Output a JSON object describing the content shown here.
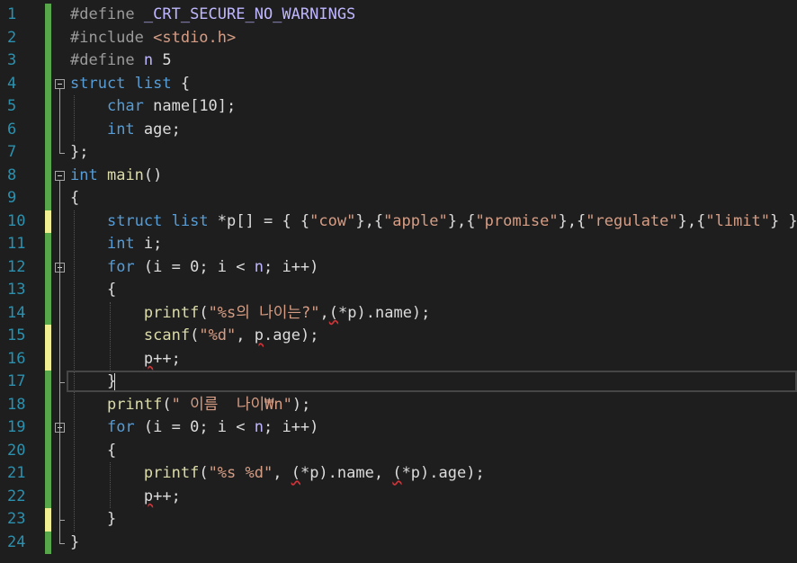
{
  "editor": {
    "lines": [
      {
        "n": "1",
        "tokens": [
          {
            "c": "pp",
            "t": "#define "
          },
          {
            "c": "macro",
            "t": "_CRT_SECURE_NO_WARNINGS"
          }
        ]
      },
      {
        "n": "2",
        "tokens": [
          {
            "c": "pp",
            "t": "#include "
          },
          {
            "c": "str",
            "t": "<stdio.h>"
          }
        ]
      },
      {
        "n": "3",
        "tokens": [
          {
            "c": "pp",
            "t": "#define "
          },
          {
            "c": "macro",
            "t": "n"
          },
          {
            "c": "id",
            "t": " 5"
          }
        ]
      },
      {
        "n": "4",
        "tokens": [
          {
            "c": "kw",
            "t": "struct "
          },
          {
            "c": "kw",
            "t": "list"
          },
          {
            "c": "id",
            "t": " {"
          }
        ]
      },
      {
        "n": "5",
        "tokens": [
          {
            "c": "id",
            "t": "    "
          },
          {
            "c": "kw",
            "t": "char"
          },
          {
            "c": "id",
            "t": " name[10];"
          }
        ]
      },
      {
        "n": "6",
        "tokens": [
          {
            "c": "id",
            "t": "    "
          },
          {
            "c": "kw",
            "t": "int"
          },
          {
            "c": "id",
            "t": " age;"
          }
        ]
      },
      {
        "n": "7",
        "tokens": [
          {
            "c": "id",
            "t": "};"
          }
        ]
      },
      {
        "n": "8",
        "tokens": [
          {
            "c": "kw",
            "t": "int"
          },
          {
            "c": "id",
            "t": " "
          },
          {
            "c": "fn",
            "t": "main"
          },
          {
            "c": "id",
            "t": "()"
          }
        ]
      },
      {
        "n": "9",
        "tokens": [
          {
            "c": "id",
            "t": "{"
          }
        ]
      },
      {
        "n": "10",
        "tokens": [
          {
            "c": "id",
            "t": "    "
          },
          {
            "c": "kw",
            "t": "struct "
          },
          {
            "c": "kw",
            "t": "list"
          },
          {
            "c": "id",
            "t": " *p[] = { {"
          },
          {
            "c": "str",
            "t": "\"cow\""
          },
          {
            "c": "id",
            "t": "},{"
          },
          {
            "c": "str",
            "t": "\"apple\""
          },
          {
            "c": "id",
            "t": "},{"
          },
          {
            "c": "str",
            "t": "\"promise\""
          },
          {
            "c": "id",
            "t": "},{"
          },
          {
            "c": "str",
            "t": "\"regulate\""
          },
          {
            "c": "id",
            "t": "},{"
          },
          {
            "c": "str",
            "t": "\"limit\""
          },
          {
            "c": "id",
            "t": "} };"
          }
        ]
      },
      {
        "n": "11",
        "tokens": [
          {
            "c": "id",
            "t": "    "
          },
          {
            "c": "kw",
            "t": "int"
          },
          {
            "c": "id",
            "t": " i;"
          }
        ]
      },
      {
        "n": "12",
        "tokens": [
          {
            "c": "id",
            "t": "    "
          },
          {
            "c": "kw",
            "t": "for"
          },
          {
            "c": "id",
            "t": " (i = 0; i < "
          },
          {
            "c": "macro",
            "t": "n"
          },
          {
            "c": "id",
            "t": "; i++)"
          }
        ]
      },
      {
        "n": "13",
        "tokens": [
          {
            "c": "id",
            "t": "    {"
          }
        ]
      },
      {
        "n": "14",
        "tokens": [
          {
            "c": "id",
            "t": "        "
          },
          {
            "c": "fn",
            "t": "printf"
          },
          {
            "c": "id",
            "t": "("
          },
          {
            "c": "str",
            "t": "\"%s의 나이는?\""
          },
          {
            "c": "id",
            "t": ","
          },
          {
            "c": "id err",
            "t": "("
          },
          {
            "c": "id",
            "t": "*p).name);"
          }
        ]
      },
      {
        "n": "15",
        "tokens": [
          {
            "c": "id",
            "t": "        "
          },
          {
            "c": "fn",
            "t": "scanf"
          },
          {
            "c": "id",
            "t": "("
          },
          {
            "c": "str",
            "t": "\"%d\""
          },
          {
            "c": "id",
            "t": ", "
          },
          {
            "c": "id err",
            "t": "p"
          },
          {
            "c": "id",
            "t": ".age);"
          }
        ]
      },
      {
        "n": "16",
        "tokens": [
          {
            "c": "id",
            "t": "        "
          },
          {
            "c": "id err",
            "t": "p"
          },
          {
            "c": "id",
            "t": "++;"
          }
        ]
      },
      {
        "n": "17",
        "tokens": [
          {
            "c": "id",
            "t": "    }"
          }
        ]
      },
      {
        "n": "18",
        "tokens": [
          {
            "c": "id",
            "t": "    "
          },
          {
            "c": "fn",
            "t": "printf"
          },
          {
            "c": "id",
            "t": "("
          },
          {
            "c": "str",
            "t": "\" 이름  나이₩n\""
          },
          {
            "c": "id",
            "t": ");"
          }
        ]
      },
      {
        "n": "19",
        "tokens": [
          {
            "c": "id",
            "t": "    "
          },
          {
            "c": "kw",
            "t": "for"
          },
          {
            "c": "id",
            "t": " (i = 0; i < "
          },
          {
            "c": "macro",
            "t": "n"
          },
          {
            "c": "id",
            "t": "; i++)"
          }
        ]
      },
      {
        "n": "20",
        "tokens": [
          {
            "c": "id",
            "t": "    {"
          }
        ]
      },
      {
        "n": "21",
        "tokens": [
          {
            "c": "id",
            "t": "        "
          },
          {
            "c": "fn",
            "t": "printf"
          },
          {
            "c": "id",
            "t": "("
          },
          {
            "c": "str",
            "t": "\"%s %d\""
          },
          {
            "c": "id",
            "t": ", "
          },
          {
            "c": "id err",
            "t": "("
          },
          {
            "c": "id",
            "t": "*p).name, "
          },
          {
            "c": "id err",
            "t": "("
          },
          {
            "c": "id",
            "t": "*p).age);"
          }
        ]
      },
      {
        "n": "22",
        "tokens": [
          {
            "c": "id",
            "t": "        "
          },
          {
            "c": "id err",
            "t": "p"
          },
          {
            "c": "id",
            "t": "++;"
          }
        ]
      },
      {
        "n": "23",
        "tokens": [
          {
            "c": "id",
            "t": "    }"
          }
        ]
      },
      {
        "n": "24",
        "tokens": [
          {
            "c": "id",
            "t": "}"
          }
        ]
      }
    ]
  },
  "colors": {
    "background": "#1e1e1e",
    "line_number": "#2b91af",
    "keyword": "#569cd6",
    "string": "#d69d85",
    "macro": "#beb7ff",
    "function": "#dcdcaa",
    "change_saved": "#57a64a",
    "change_unsaved": "#efef91"
  }
}
